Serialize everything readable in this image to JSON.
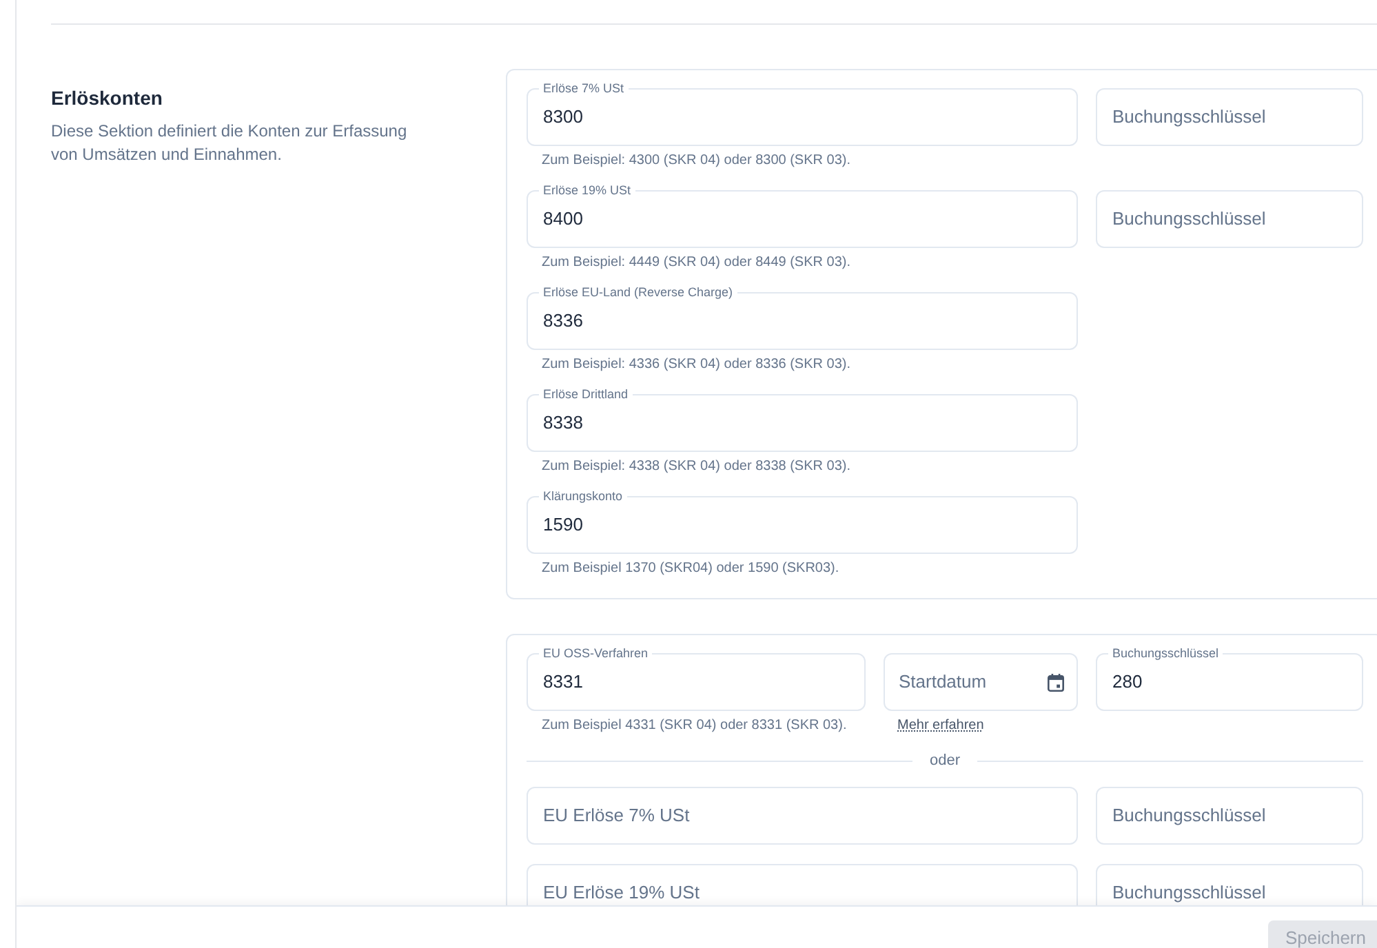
{
  "section": {
    "title": "Erlöskonten",
    "description": "Diese Sektion definiert die Konten zur Erfassung von Umsätzen und Einnahmen."
  },
  "revenue_accounts": [
    {
      "account": {
        "label": "Erlöse 7% USt",
        "value": "8300"
      },
      "helper_text": "Zum Beispiel: 4300 (SKR 04) oder 8300 (SKR 03).",
      "booking_key": {
        "placeholder": "Buchungsschlüssel"
      }
    },
    {
      "account": {
        "label": "Erlöse 19% USt",
        "value": "8400"
      },
      "helper_text": "Zum Beispiel: 4449 (SKR 04) oder 8449 (SKR 03).",
      "booking_key": {
        "placeholder": "Buchungsschlüssel"
      }
    },
    {
      "account": {
        "label": "Erlöse EU-Land (Reverse Charge)",
        "value": "8336"
      },
      "helper_text": "Zum Beispiel: 4336 (SKR 04) oder 8336 (SKR 03)."
    },
    {
      "account": {
        "label": "Erlöse Drittland",
        "value": "8338"
      },
      "helper_text": "Zum Beispiel: 4338 (SKR 04) oder 8338 (SKR 03)."
    },
    {
      "account": {
        "label": "Klärungskonto",
        "value": "1590"
      },
      "helper_text": "Zum Beispiel 1370 (SKR04) oder 1590 (SKR03)."
    }
  ],
  "oss": {
    "account": {
      "label": "EU OSS-Verfahren",
      "value": "8331"
    },
    "helper_text": "Zum Beispiel 4331 (SKR 04) oder 8331 (SKR 03).",
    "start_date": {
      "placeholder": "Startdatum"
    },
    "more_link": "Mehr erfahren",
    "booking_key": {
      "label": "Buchungsschlüssel",
      "value": "280"
    },
    "separator": "oder",
    "eu_accounts": [
      {
        "account": {
          "placeholder": "EU Erlöse 7% USt"
        },
        "booking_key": {
          "placeholder": "Buchungsschlüssel"
        }
      },
      {
        "account": {
          "placeholder": "EU Erlöse 19% USt"
        },
        "booking_key": {
          "placeholder": "Buchungsschlüssel"
        }
      }
    ]
  },
  "footer": {
    "save_button": {
      "label": "Speichern",
      "disabled": true
    }
  }
}
